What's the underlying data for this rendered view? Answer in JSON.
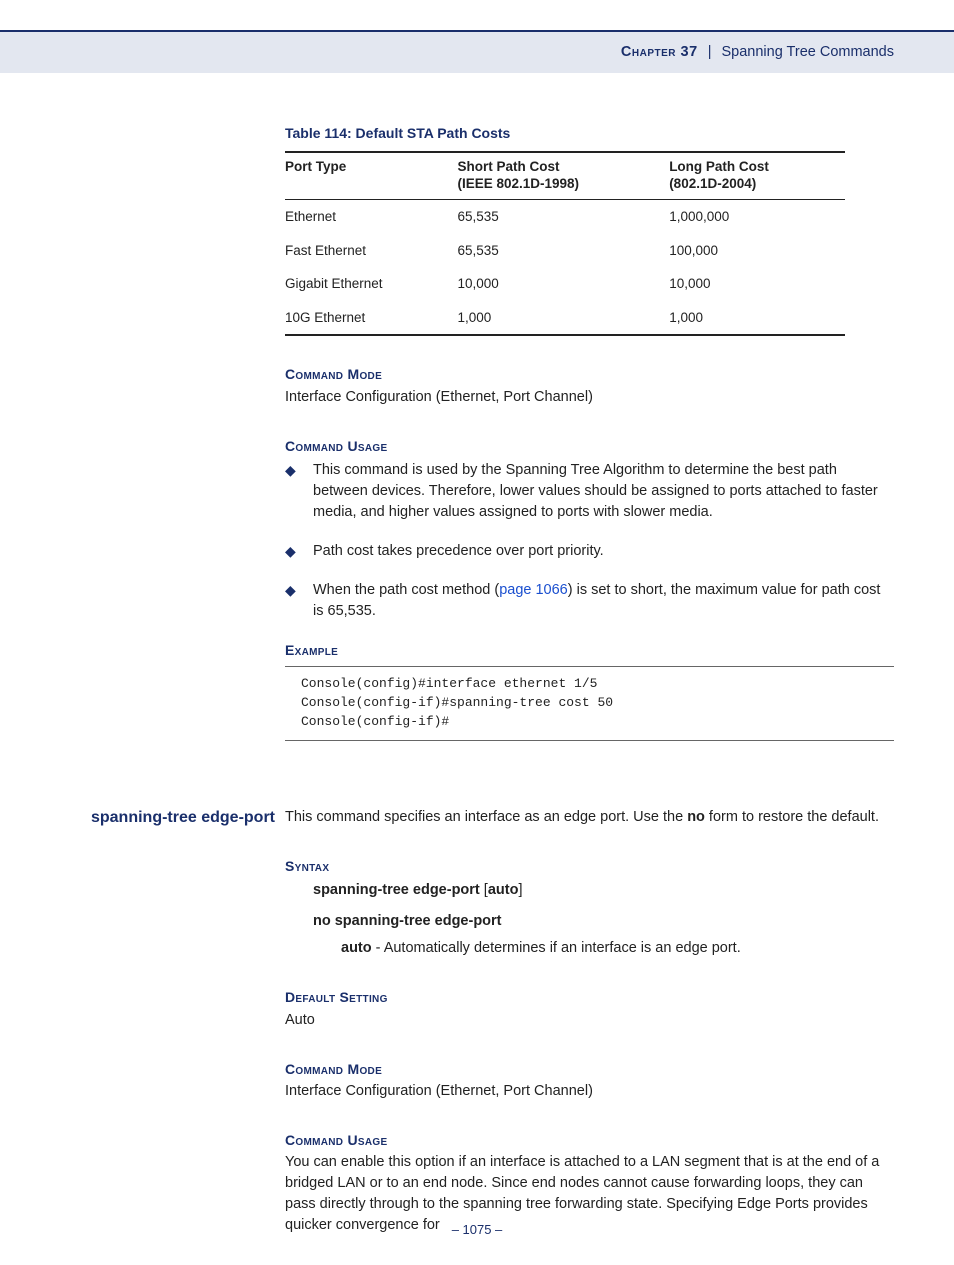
{
  "header": {
    "chapter": "Chapter 37",
    "title": "Spanning Tree Commands"
  },
  "table": {
    "title": "Table 114: Default STA Path Costs",
    "headers": [
      "Port Type",
      "Short Path Cost\n(IEEE 802.1D-1998)",
      "Long Path Cost\n(802.1D-2004)"
    ],
    "rows": [
      [
        "Ethernet",
        "65,535",
        "1,000,000"
      ],
      [
        "Fast Ethernet",
        "65,535",
        "100,000"
      ],
      [
        "Gigabit Ethernet",
        "10,000",
        "10,000"
      ],
      [
        "10G Ethernet",
        "1,000",
        "1,000"
      ]
    ]
  },
  "section1": {
    "cmd_mode_h": "Command Mode",
    "cmd_mode": "Interface Configuration (Ethernet, Port Channel)",
    "cmd_usage_h": "Command Usage",
    "bullets": {
      "b1": "This command is used by the Spanning Tree Algorithm to determine the best path between devices. Therefore, lower values should be assigned to ports attached to faster media, and higher values assigned to ports with slower media.",
      "b2": "Path cost takes precedence over port priority.",
      "b3a": "When the path cost method (",
      "b3link": "page 1066",
      "b3b": ") is set to short, the maximum value for path cost is 65,535."
    },
    "example_h": "Example",
    "example_code": "Console(config)#interface ethernet 1/5\nConsole(config-if)#spanning-tree cost 50\nConsole(config-if)#"
  },
  "section2": {
    "side_label": "spanning-tree edge-port",
    "intro_a": "This command specifies an interface as an edge port. Use the ",
    "intro_no": "no",
    "intro_b": " form to restore the default.",
    "syntax_h": "Syntax",
    "syntax_line1_a": "spanning-tree edge-port",
    "syntax_line1_b": " [",
    "syntax_line1_c": "auto",
    "syntax_line1_d": "]",
    "syntax_line2": "no spanning-tree edge-port",
    "param_name": "auto",
    "param_desc": " - Automatically determines if an interface is an edge port.",
    "default_h": "Default Setting",
    "default_v": "Auto",
    "cmd_mode_h": "Command Mode",
    "cmd_mode": "Interface Configuration (Ethernet, Port Channel)",
    "cmd_usage_h": "Command Usage",
    "cmd_usage": "You can enable this option if an interface is attached to a LAN segment that is at the end of a bridged LAN or to an end node. Since end nodes cannot cause forwarding loops, they can pass directly through to the spanning tree forwarding state. Specifying Edge Ports provides quicker convergence for"
  },
  "page_number": "–  1075  –",
  "chart_data": {
    "type": "table",
    "title": "Table 114: Default STA Path Costs",
    "columns": [
      "Port Type",
      "Short Path Cost (IEEE 802.1D-1998)",
      "Long Path Cost (802.1D-2004)"
    ],
    "rows": [
      {
        "port_type": "Ethernet",
        "short": 65535,
        "long": 1000000
      },
      {
        "port_type": "Fast Ethernet",
        "short": 65535,
        "long": 100000
      },
      {
        "port_type": "Gigabit Ethernet",
        "short": 10000,
        "long": 10000
      },
      {
        "port_type": "10G Ethernet",
        "short": 1000,
        "long": 1000
      }
    ]
  }
}
